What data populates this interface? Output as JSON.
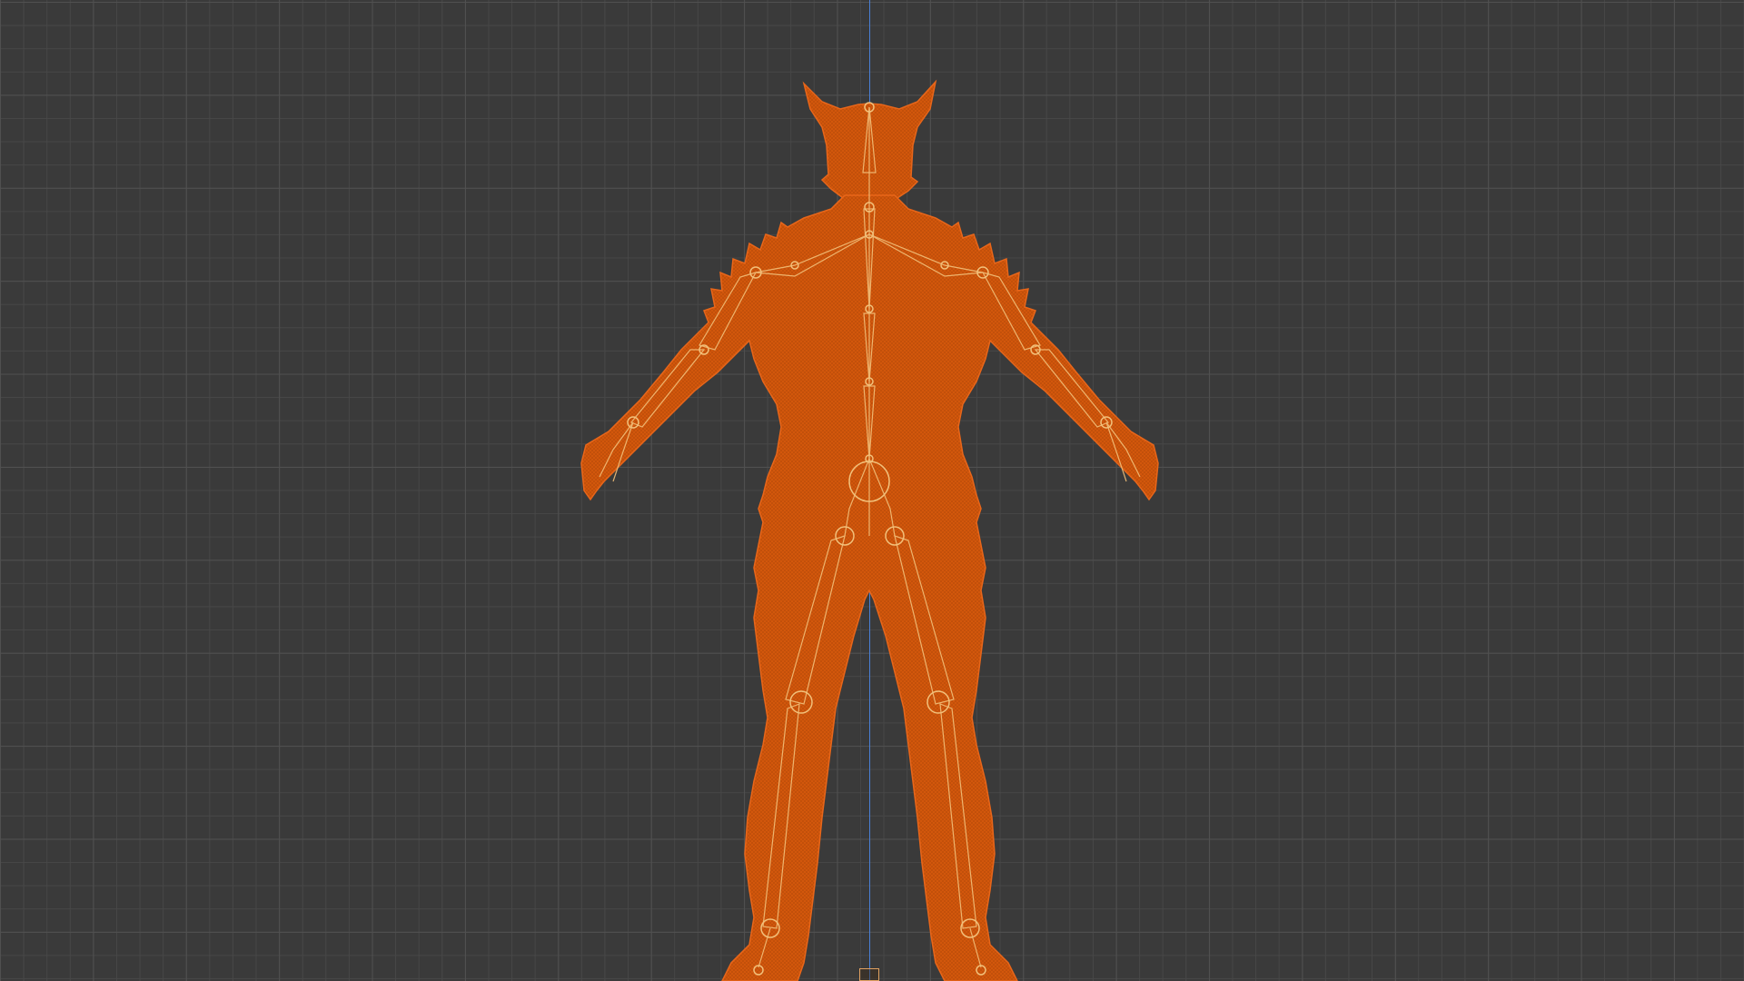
{
  "viewport": {
    "view": "front-orthographic",
    "background_color": "#3a3a3a",
    "grid_color": "#474747",
    "axis_color": "#4a7fd6"
  },
  "character": {
    "name_visible": "",
    "mesh_color": "#d4580c",
    "mesh_edge_color": "#f07020",
    "bone_color": "#f2c07a",
    "selected": true
  },
  "icons": {
    "origin": "origin-icon"
  }
}
